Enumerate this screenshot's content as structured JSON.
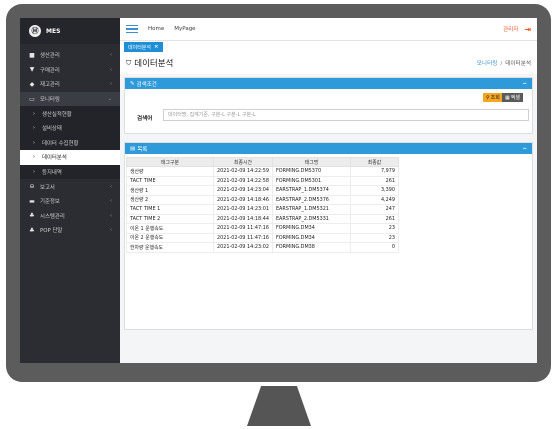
{
  "app": {
    "name": "MES"
  },
  "sidebar": {
    "items": [
      {
        "label": "생산관리",
        "icon": "factory-icon",
        "glyph": "■"
      },
      {
        "label": "구매관리",
        "icon": "cart-icon",
        "glyph": "▼"
      },
      {
        "label": "재고관리",
        "icon": "truck-icon",
        "glyph": "◆"
      },
      {
        "label": "모니터링",
        "icon": "monitor-icon",
        "glyph": "▭"
      },
      {
        "label": "생산실적현황",
        "icon": "chevron-right-icon",
        "glyph": "›"
      },
      {
        "label": "설비상태",
        "icon": "chevron-right-icon",
        "glyph": "›"
      },
      {
        "label": "데이터 수집현황",
        "icon": "chevron-right-icon",
        "glyph": "›"
      },
      {
        "label": "데이터분석",
        "icon": "chevron-right-icon",
        "glyph": "›"
      },
      {
        "label": "등지내역",
        "icon": "chevron-right-icon",
        "glyph": "›"
      },
      {
        "label": "보고서",
        "icon": "report-icon",
        "glyph": "⊖"
      },
      {
        "label": "기준정보",
        "icon": "folder-icon",
        "glyph": "▬"
      },
      {
        "label": "시스템관리",
        "icon": "users-icon",
        "glyph": "♣"
      },
      {
        "label": "POP 단말",
        "icon": "terminal-icon",
        "glyph": "♣"
      }
    ]
  },
  "topbar": {
    "home": "Home",
    "mypage": "MyPage",
    "user": "관리자"
  },
  "tab": {
    "label": "데이터분석"
  },
  "page": {
    "title": "데이터분석",
    "breadcrumb": [
      "모니터링",
      "데이터분석"
    ]
  },
  "search_panel": {
    "title": "검색조건",
    "search_button": "조회",
    "excel_button": "엑셀",
    "field_label": "검색어",
    "placeholder": "데이터명, 집계기준, 구분-L 구분-L 구분-L"
  },
  "list_panel": {
    "title": "목록",
    "columns": [
      "태그구분",
      "최종시간",
      "태그명",
      "최종값"
    ],
    "rows": [
      [
        "생산량",
        "2021-02-09 14:22:59",
        "FORMING.DM5370",
        "7,979"
      ],
      [
        "TACT TIME",
        "2021-02-09 14:22:58",
        "FORMING.DM5301",
        "261"
      ],
      [
        "생산량 1",
        "2021-02-09 14:23:04",
        "EARSTRAP_1.DM5374",
        "3,390"
      ],
      [
        "생산량 2",
        "2021-02-09 14:18:46",
        "EARSTRAP_2.DM5376",
        "4,249"
      ],
      [
        "TACT TIME 1",
        "2021-02-09 14:23:01",
        "EARSTRAP_1.DM5321",
        "247"
      ],
      [
        "TACT TIME 2",
        "2021-02-09 14:18:44",
        "EARSTRAP_2.DM5331",
        "261"
      ],
      [
        "이온 1 운행속도",
        "2021-02-09 11:47:16",
        "FORMING.DM34",
        "23"
      ],
      [
        "이온 2 운행속도",
        "2021-02-09 11:47:16",
        "FORMING.DM34",
        "23"
      ],
      [
        "한차량 운행속도",
        "2021-02-09 14:23:02",
        "FORMING.DM38",
        "0"
      ]
    ]
  },
  "colors": {
    "accent": "#2f9ad9",
    "sidebar": "#2b2d33",
    "monitor_frame": "#5c5c5c",
    "search_button": "#f5a623",
    "excel_button": "#5a5a5a",
    "user_link": "#e45a2b"
  }
}
